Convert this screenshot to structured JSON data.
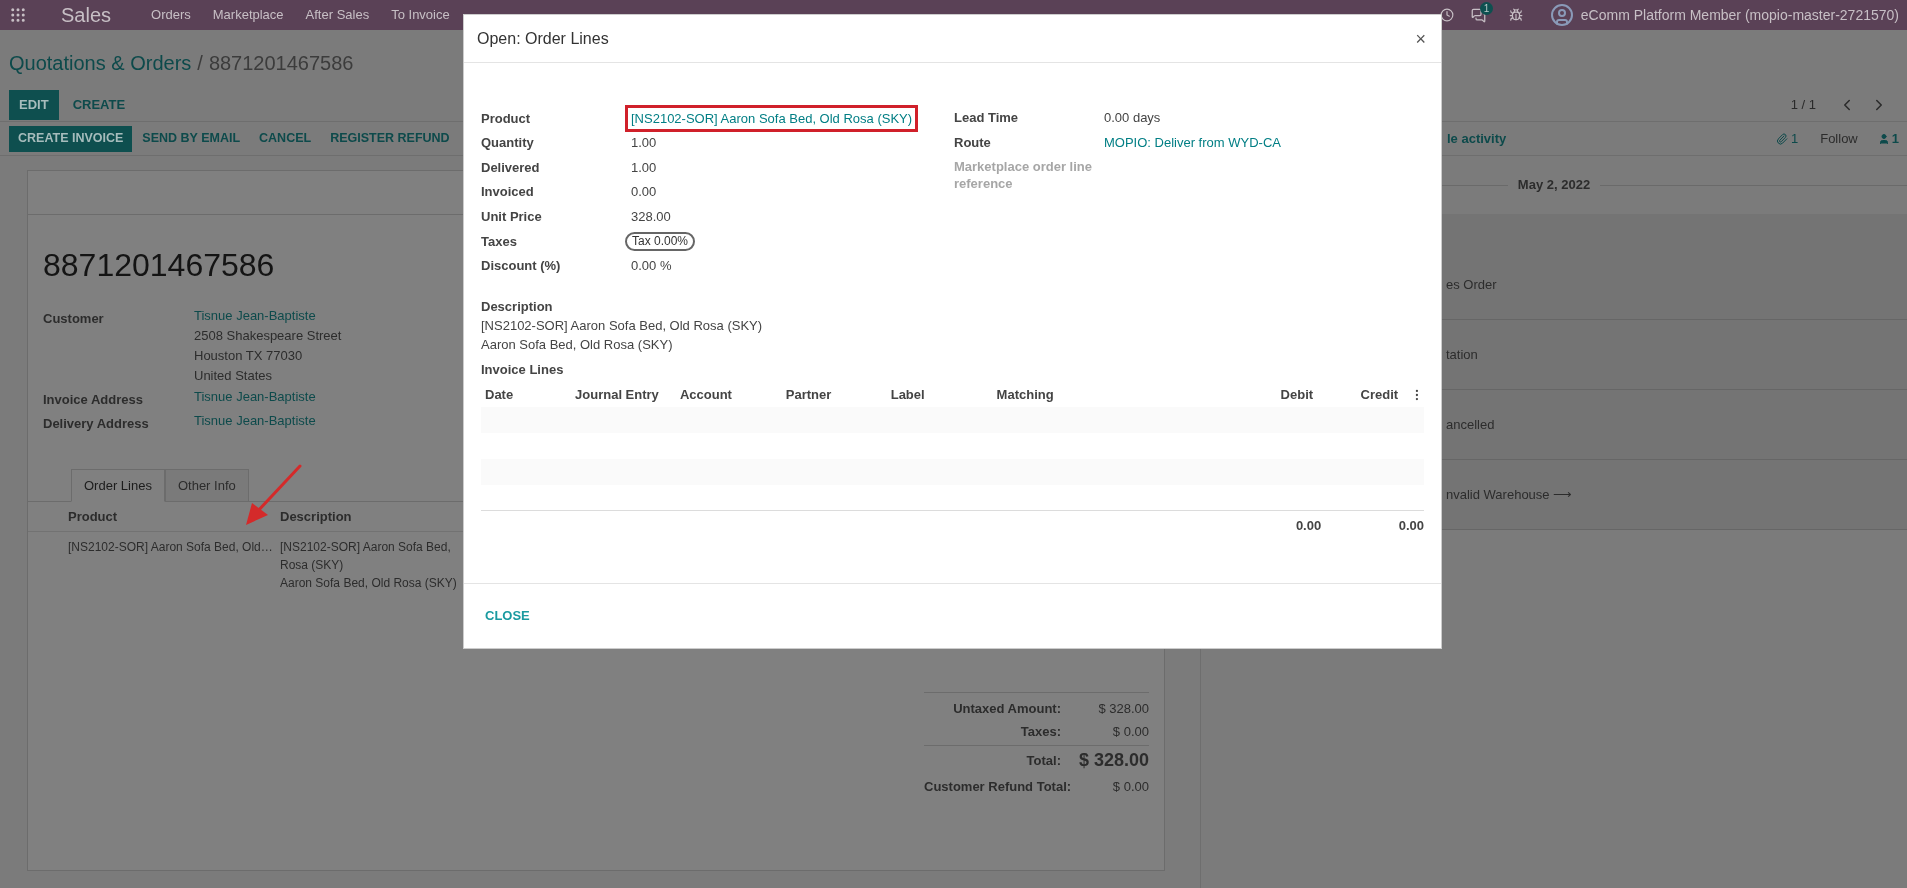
{
  "navbar": {
    "app_name": "Sales",
    "menu": [
      "Orders",
      "Marketplace",
      "After Sales",
      "To Invoice"
    ],
    "chat_count": "1",
    "user": "eComm Platform Member (mopio-master-2721570)"
  },
  "breadcrumb": {
    "parent": "Quotations & Orders",
    "separator": "/",
    "current": "8871201467586"
  },
  "control_buttons": [
    {
      "label": "EDIT",
      "primary": true
    },
    {
      "label": "CREATE",
      "primary": false
    }
  ],
  "pager": "1 / 1",
  "status_buttons": [
    {
      "label": "CREATE INVOICE",
      "primary": true
    },
    {
      "label": "SEND BY EMAIL",
      "primary": false
    },
    {
      "label": "CANCEL",
      "primary": false
    },
    {
      "label": "REGISTER REFUND",
      "primary": false
    }
  ],
  "sheet": {
    "title": "8871201467586",
    "fields": [
      {
        "label": "Customer",
        "value": "Tisnue Jean-Baptiste",
        "address": [
          "2508 Shakespeare Street",
          "Houston TX 77030",
          "United States"
        ]
      },
      {
        "label": "Invoice Address",
        "value": "Tisnue Jean-Baptiste"
      },
      {
        "label": "Delivery Address",
        "value": "Tisnue Jean-Baptiste"
      }
    ],
    "tabs": [
      {
        "label": "Order Lines",
        "selected": true
      },
      {
        "label": "Other Info",
        "selected": false
      }
    ],
    "order_lines": {
      "columns": [
        "Product",
        "Description"
      ],
      "rows": [
        {
          "product": "[NS2102-SOR] Aaron Sofa Bed, Old…",
          "description": [
            "[NS2102-SOR] Aaron Sofa Bed,",
            "Rosa (SKY)",
            "Aaron Sofa Bed, Old Rosa (SKY)"
          ]
        }
      ]
    },
    "totals": [
      {
        "label": "Untaxed Amount:",
        "value": "$ 328.00",
        "kind": "normal"
      },
      {
        "label": "Taxes:",
        "value": "$ 0.00",
        "kind": "normal"
      },
      {
        "label": "Total:",
        "value": "$ 328.00",
        "kind": "total"
      },
      {
        "label": "Customer Refund Total:",
        "value": "$ 0.00",
        "kind": "normal"
      }
    ]
  },
  "chatter": {
    "activity": "le activity",
    "attachments": "1",
    "follow": "Follow",
    "followers": "1",
    "date": "May 2, 2022",
    "messages": [
      "es Order",
      "tation",
      "ancelled",
      "nvalid Warehouse ⟶"
    ]
  },
  "dialog": {
    "title": "Open: Order Lines",
    "close_icon": "×",
    "left_fields": [
      {
        "label": "Product",
        "value": "[NS2102-SOR] Aaron Sofa Bed, Old Rosa (SKY)",
        "kind": "link",
        "highlighted": true
      },
      {
        "label": "Quantity",
        "value": "1.00",
        "kind": "text",
        "highlighted": false
      },
      {
        "label": "Delivered",
        "value": "1.00",
        "kind": "text",
        "highlighted": false
      },
      {
        "label": "Invoiced",
        "value": "0.00",
        "kind": "text",
        "highlighted": false
      },
      {
        "label": "Unit Price",
        "value": "328.00",
        "kind": "text",
        "highlighted": false
      },
      {
        "label": "Taxes",
        "value": "Tax 0.00%",
        "kind": "tag",
        "highlighted": false
      },
      {
        "label": "Discount (%)",
        "value": "0.00 %",
        "kind": "text",
        "highlighted": false
      }
    ],
    "right_fields": [
      {
        "label": "Lead Time",
        "value": "0.00 days",
        "kind": "text",
        "muted": false
      },
      {
        "label": "Route",
        "value": "MOPIO: Deliver from WYD-CA",
        "kind": "link",
        "muted": false
      },
      {
        "label": "Marketplace order line reference",
        "muted": true
      }
    ],
    "description_label": "Description",
    "description": [
      "[NS2102-SOR] Aaron Sofa Bed, Old Rosa (SKY)",
      "Aaron Sofa Bed, Old Rosa (SKY)"
    ],
    "invoice_lines": {
      "title": "Invoice Lines",
      "columns": [
        "Date",
        "Journal Entry",
        "Account",
        "Partner",
        "Label",
        "Matching",
        "Debit",
        "Credit"
      ],
      "totals": {
        "debit": "0.00",
        "credit": "0.00"
      }
    },
    "footer_button": "CLOSE"
  }
}
